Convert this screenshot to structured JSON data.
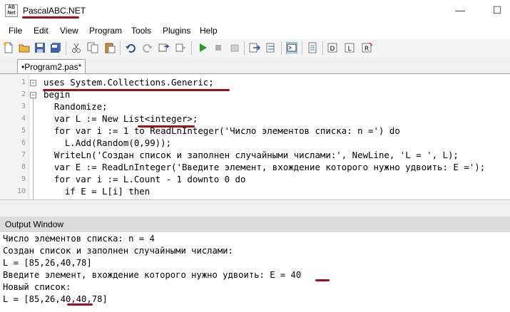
{
  "window": {
    "title": "PascalABC.NET",
    "minimize_glyph": "—",
    "maximize_glyph": "☐",
    "icon_text": "AB\nNet"
  },
  "menu": [
    "File",
    "Edit",
    "View",
    "Program",
    "Tools",
    "Plugins",
    "Help"
  ],
  "toolbar_icons": [
    "new-file-icon",
    "open-folder-icon",
    "save-icon",
    "save-all-icon",
    "cut-icon",
    "copy-icon",
    "paste-icon",
    "undo-icon",
    "redo-icon",
    "compile-icon",
    "forward-icon",
    "run-icon",
    "stop-icon",
    "debug-step-icon",
    "step-over-icon",
    "output-window-icon",
    "options-icon",
    "format-code-icon",
    "reference-icon",
    "doc-icon"
  ],
  "editor": {
    "tab_label": "•Program2.pas*",
    "line_numbers": [
      "1",
      "2",
      "3",
      "4",
      "5",
      "6",
      "7",
      "8",
      "9",
      "10"
    ],
    "lines": [
      "uses System.Collections.Generic;",
      "begin",
      "  Randomize;",
      "  var L := New List<integer>;",
      "  for var i := 1 to ReadLnInteger('Число элементов списка: n =') do",
      "    L.Add(Random(0,99));",
      "  WriteLn('Создан список и заполнен случайными числами:', NewLine, 'L = ', L);",
      "  var E := ReadLnInteger('Введите элемент, вхождение которого нужно удвоить: E =');",
      "  for var i := L.Count - 1 downto 0 do",
      "    if E = L[i] then"
    ]
  },
  "output": {
    "title": "Output Window",
    "lines": [
      "Число элементов списка: n = 4",
      "Создан список и заполнен случайными числами:",
      "L = [85,26,40,78]",
      "Введите элемент, вхождение которого нужно удвоить: E = 40",
      "Новый список:",
      "L = [85,26,40,40,78]"
    ]
  },
  "colors": {
    "annotation": "#a01020",
    "string": "#0000c0",
    "keyword": "#000000"
  }
}
